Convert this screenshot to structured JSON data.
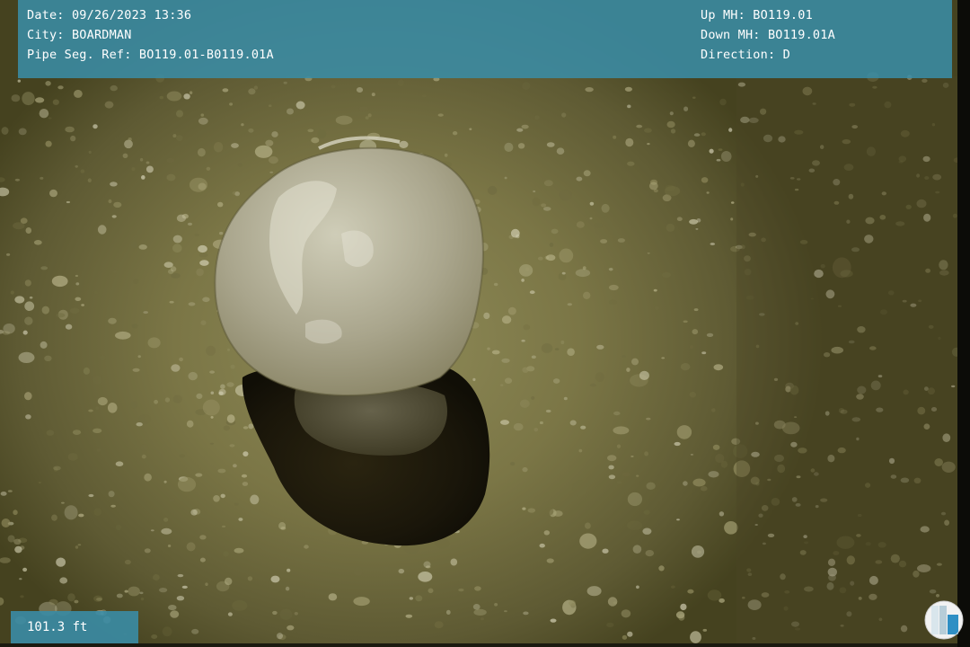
{
  "overlay": {
    "left_lines": [
      "Date: 09/26/2023 13:36",
      "City: BOARDMAN",
      "Pipe Seg. Ref: BO119.01-B0119.01A"
    ],
    "right_lines": [
      "Up MH: BO119.01",
      "Down MH: BO119.01A",
      "Direction: D"
    ],
    "distance": "101.3 ft"
  },
  "colors": {
    "banner": "#3a8ca5",
    "pipe_wall": "#7b7646",
    "opening_dark": "#1e1a0c",
    "plug_face": "#b8b5a0"
  }
}
